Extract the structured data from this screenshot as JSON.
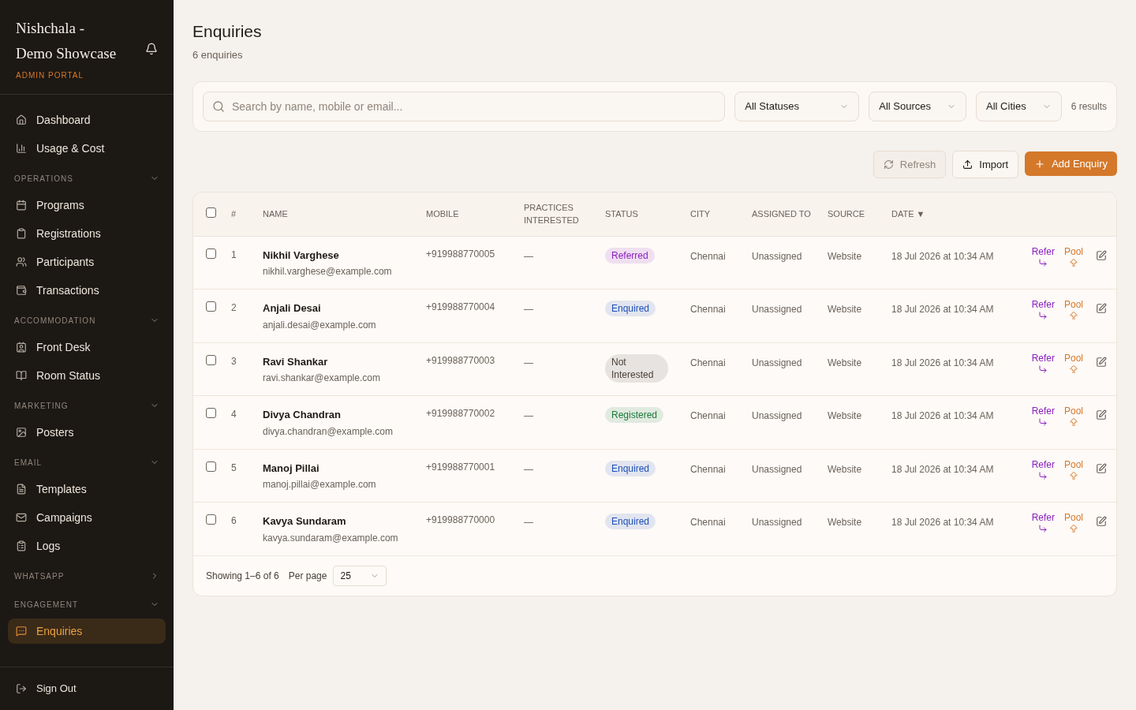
{
  "sidebar": {
    "brand": "Nishchala - Demo Showcase",
    "subtitle": "ADMIN PORTAL",
    "main_items": [
      {
        "label": "Dashboard",
        "selected": false
      },
      {
        "label": "Usage & Cost",
        "selected": false
      }
    ],
    "sections": [
      {
        "title": "OPERATIONS",
        "expanded": true,
        "items": [
          {
            "label": "Programs",
            "selected": false
          },
          {
            "label": "Registrations",
            "selected": false
          },
          {
            "label": "Participants",
            "selected": false
          },
          {
            "label": "Transactions",
            "selected": false
          }
        ]
      },
      {
        "title": "ACCOMMODATION",
        "expanded": true,
        "items": [
          {
            "label": "Front Desk",
            "selected": false
          },
          {
            "label": "Room Status",
            "selected": false
          }
        ]
      },
      {
        "title": "MARKETING",
        "expanded": true,
        "items": [
          {
            "label": "Posters",
            "selected": false
          }
        ]
      },
      {
        "title": "EMAIL",
        "expanded": true,
        "items": [
          {
            "label": "Templates",
            "selected": false
          },
          {
            "label": "Campaigns",
            "selected": false
          },
          {
            "label": "Logs",
            "selected": false
          }
        ]
      },
      {
        "title": "WHATSAPP",
        "expanded": false
      },
      {
        "title": "ENGAGEMENT",
        "expanded": true,
        "items": [
          {
            "label": "Enquiries",
            "selected": true
          }
        ]
      }
    ],
    "sign_out": "Sign Out"
  },
  "header": {
    "title": "Enquiries",
    "subtitle": "6 enquiries"
  },
  "filters": {
    "search_placeholder": "Search by name, mobile or email...",
    "selects": [
      "All Statuses",
      "All Sources",
      "All Cities"
    ],
    "results": "6 results"
  },
  "actions": {
    "refresh": {
      "label": "Refresh",
      "disabled": true
    },
    "import": "Import",
    "add": "Add Enquiry"
  },
  "table": {
    "columns": [
      "#",
      "NAME",
      "MOBILE",
      "PRACTICES INTERESTED",
      "STATUS",
      "CITY",
      "ASSIGNED TO",
      "SOURCE",
      "DATE"
    ],
    "sort_indicator": "▼",
    "rows": [
      {
        "checked": false,
        "index": "1",
        "name": "Nikhil Varghese",
        "email": "nikhil.varghese@example.com",
        "mobile": "+919988770005",
        "practices": "—",
        "status": {
          "label": "Referred",
          "color": "#8a1fc0"
        },
        "city": "Chennai",
        "assigned": "Unassigned",
        "source": "Website",
        "date": "18 Jul 2026 at 10:34 AM",
        "refer": "Refer",
        "pool": "Pool"
      },
      {
        "checked": false,
        "index": "2",
        "name": "Anjali Desai",
        "email": "anjali.desai@example.com",
        "mobile": "+919988770004",
        "practices": "—",
        "status": {
          "label": "Enquired",
          "color": "#1d4fb8"
        },
        "city": "Chennai",
        "assigned": "Unassigned",
        "source": "Website",
        "date": "18 Jul 2026 at 10:34 AM",
        "refer": "Refer",
        "pool": "Pool"
      },
      {
        "checked": false,
        "index": "3",
        "name": "Ravi Shankar",
        "email": "ravi.shankar@example.com",
        "mobile": "+919988770003",
        "practices": "—",
        "status": {
          "label": "Not Interested",
          "color": "#4a4038"
        },
        "city": "Chennai",
        "assigned": "Unassigned",
        "source": "Website",
        "date": "18 Jul 2026 at 10:34 AM",
        "refer": "Refer",
        "pool": "Pool"
      },
      {
        "checked": false,
        "index": "4",
        "name": "Divya Chandran",
        "email": "divya.chandran@example.com",
        "mobile": "+919988770002",
        "practices": "—",
        "status": {
          "label": "Registered",
          "color": "#1c7a3a"
        },
        "city": "Chennai",
        "assigned": "Unassigned",
        "source": "Website",
        "date": "18 Jul 2026 at 10:34 AM",
        "refer": "Refer",
        "pool": "Pool"
      },
      {
        "checked": false,
        "index": "5",
        "name": "Manoj Pillai",
        "email": "manoj.pillai@example.com",
        "mobile": "+919988770001",
        "practices": "—",
        "status": {
          "label": "Enquired",
          "color": "#1d4fb8"
        },
        "city": "Chennai",
        "assigned": "Unassigned",
        "source": "Website",
        "date": "18 Jul 2026 at 10:34 AM",
        "refer": "Refer",
        "pool": "Pool"
      },
      {
        "checked": false,
        "index": "6",
        "name": "Kavya Sundaram",
        "email": "kavya.sundaram@example.com",
        "mobile": "+919988770000",
        "practices": "—",
        "status": {
          "label": "Enquired",
          "color": "#1d4fb8"
        },
        "city": "Chennai",
        "assigned": "Unassigned",
        "source": "Website",
        "date": "18 Jul 2026 at 10:34 AM",
        "refer": "Refer",
        "pool": "Pool"
      }
    ],
    "select_all_checked": false,
    "footer": {
      "showing": "Showing 1–6 of 6",
      "per_page_label": "Per page",
      "per_page": "25"
    }
  }
}
